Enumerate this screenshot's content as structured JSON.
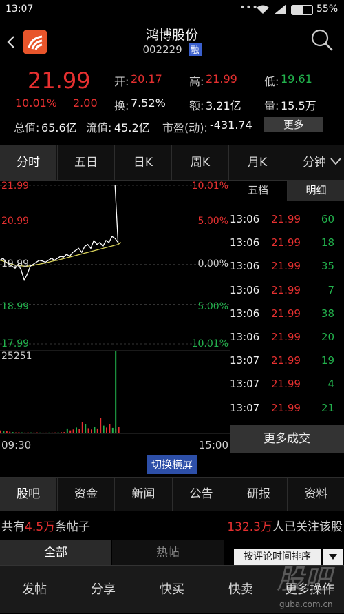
{
  "status_bar": {
    "time": "13:07",
    "battery": "55%"
  },
  "header": {
    "back_icon": "chevron-left",
    "stock_name": "鸿博股份",
    "stock_code": "002229",
    "margin_badge": "融",
    "search_icon": "search"
  },
  "quote": {
    "price": "21.99",
    "change_pct": "10.01%",
    "change_amt": "2.00",
    "open_label": "开:",
    "open": "20.17",
    "high_label": "高:",
    "high": "21.99",
    "low_label": "低:",
    "low": "19.61",
    "turnover_label": "换:",
    "turnover": "7.52%",
    "amount_label": "额:",
    "amount": "3.21亿",
    "volume_label": "量:",
    "volume": "15.5万",
    "mktcap_label": "总值:",
    "mktcap": "65.6亿",
    "float_label": "流值:",
    "float": "45.2亿",
    "pe_label": "市盈(动):",
    "pe": "-431.74",
    "more_button": "更多"
  },
  "chart_tabs": [
    "分时",
    "五日",
    "日K",
    "周K",
    "月K",
    "分钟"
  ],
  "chart": {
    "y_left": [
      "21.99",
      "20.99",
      "19.99",
      "18.99",
      "17.99"
    ],
    "y_right": [
      "10.01%",
      "5.00%",
      "0.00%",
      "5.00%",
      "10.01%"
    ],
    "vol_max": "25251",
    "time_start": "09:30",
    "time_end": "15:00",
    "switch_button": "切换横屏"
  },
  "chart_data": {
    "type": "line",
    "title": "",
    "xlabel": "",
    "ylabel": "",
    "x_range": [
      "09:30",
      "15:00"
    ],
    "ylim": [
      17.99,
      21.99
    ],
    "price_series": [
      20.1,
      20.15,
      20.05,
      20.0,
      19.95,
      19.9,
      20.0,
      19.85,
      19.6,
      19.75,
      19.95,
      20.0,
      20.05,
      20.1,
      20.08,
      20.05,
      20.1,
      20.15,
      20.1,
      20.15,
      20.2,
      20.18,
      20.25,
      20.2,
      20.3,
      20.35,
      20.4,
      20.3,
      20.45,
      20.5,
      20.4,
      20.6,
      20.5,
      20.55,
      20.45,
      20.6,
      20.55,
      20.7,
      20.65,
      20.55,
      21.99
    ],
    "avg_series": [
      20.1,
      20.08,
      20.05,
      20.02,
      20.0,
      19.98,
      19.97,
      19.96,
      19.95,
      19.95,
      19.96,
      19.97,
      19.99,
      20.0,
      20.02,
      20.03,
      20.05,
      20.07,
      20.09,
      20.1,
      20.12,
      20.14,
      20.16,
      20.18,
      20.2,
      20.22,
      20.24,
      20.26,
      20.28,
      20.3,
      20.32,
      20.34,
      20.36,
      20.38,
      20.4,
      20.42,
      20.44,
      20.46,
      20.48,
      20.5,
      20.55
    ],
    "volume_max": 25251,
    "volume": [
      900,
      600,
      700,
      500,
      400,
      300,
      350,
      300,
      250,
      300,
      280,
      260,
      300,
      250,
      240,
      230,
      260,
      250,
      270,
      300,
      350,
      400,
      1500,
      900,
      1200,
      1800,
      1400,
      3500,
      2800,
      1600,
      1200,
      1900,
      1500,
      4800,
      2400,
      1800,
      2900,
      1700,
      1500,
      2100,
      25251
    ]
  },
  "side_tabs": [
    "五档",
    "明细"
  ],
  "details": [
    {
      "time": "13:06",
      "price": "21.99",
      "vol": "60"
    },
    {
      "time": "13:06",
      "price": "21.99",
      "vol": "18"
    },
    {
      "time": "13:06",
      "price": "21.99",
      "vol": "35"
    },
    {
      "time": "13:06",
      "price": "21.99",
      "vol": "7"
    },
    {
      "time": "13:06",
      "price": "21.99",
      "vol": "38"
    },
    {
      "time": "13:06",
      "price": "21.99",
      "vol": "20"
    },
    {
      "time": "13:07",
      "price": "21.99",
      "vol": "19"
    },
    {
      "time": "13:07",
      "price": "21.99",
      "vol": "4"
    },
    {
      "time": "13:07",
      "price": "21.99",
      "vol": "21"
    }
  ],
  "more_trades_button": "更多成交",
  "section_tabs": [
    "股吧",
    "资金",
    "新闻",
    "公告",
    "研报",
    "资料"
  ],
  "forum": {
    "posts_prefix": "共有",
    "posts_count": "4.5万",
    "posts_suffix": "条帖子",
    "followers": "132.3万",
    "followers_suffix": "人已关注该股"
  },
  "filter_tabs": [
    "全部",
    "热帖"
  ],
  "sort_label": "按评论时间排序",
  "bottom_bar": [
    "发帖",
    "分享",
    "快买",
    "快卖",
    "更多操作"
  ],
  "watermark": {
    "text": "股吧",
    "url": "guba.com.cn"
  },
  "colors": {
    "up": "#e63030",
    "down": "#22b14c",
    "price_line": "#ffffff",
    "avg_line": "#d8d25a",
    "accent_badge": "#3a5fcd"
  }
}
